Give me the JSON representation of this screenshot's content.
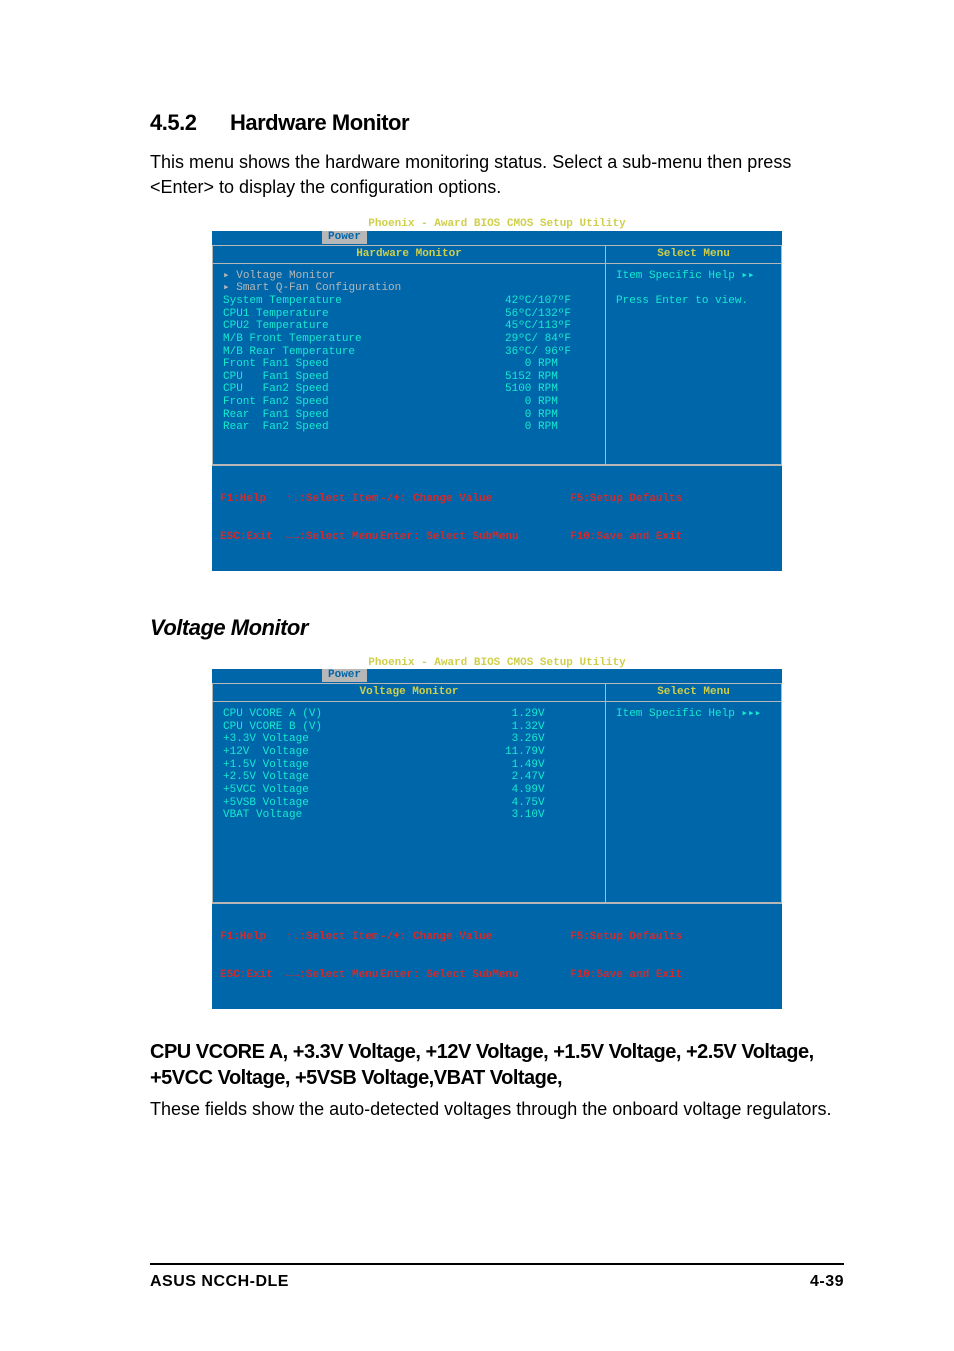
{
  "section": {
    "number": "4.5.2",
    "title": "Hardware Monitor",
    "intro": "This menu shows the hardware monitoring status. Select a sub-menu then press <Enter> to display the configuration options."
  },
  "bios_common": {
    "title": "Phoenix - Award BIOS CMOS Setup Utility",
    "tab": "Power",
    "right_header": "Select Menu",
    "help_header": "Item Specific Help",
    "footer": {
      "l1c1": "F1:Help   ↑↓:Select Item",
      "l1c2": "-/+: Change Value",
      "l1c3": "F5:Setup Defaults",
      "l2c1": "ESC:Exit  ←→:Select Menu",
      "l2c2": "Enter: Select SubMenu",
      "l2c3": "F10:Save and Exit"
    }
  },
  "bios1": {
    "left_header": "Hardware Monitor",
    "menu_items": [
      "Voltage Monitor",
      "Smart Q-Fan Configuration"
    ],
    "rows": [
      {
        "label": "System Temperature",
        "value": "42ºC/107ºF"
      },
      {
        "label": "CPU1 Temperature",
        "value": "56ºC/132ºF"
      },
      {
        "label": "CPU2 Temperature",
        "value": "45ºC/113ºF"
      },
      {
        "label": "M/B Front Temperature",
        "value": "29ºC/ 84ºF"
      },
      {
        "label": "M/B Rear Temperature",
        "value": "36ºC/ 96ºF"
      },
      {
        "label": "Front Fan1 Speed",
        "value": "   0 RPM"
      },
      {
        "label": "CPU   Fan1 Speed",
        "value": "5152 RPM"
      },
      {
        "label": "CPU   Fan2 Speed",
        "value": "5100 RPM"
      },
      {
        "label": "Front Fan2 Speed",
        "value": "   0 RPM"
      },
      {
        "label": "Rear  Fan1 Speed",
        "value": "   0 RPM"
      },
      {
        "label": "Rear  Fan2 Speed",
        "value": "   0 RPM"
      }
    ],
    "help_text": "Press Enter to view."
  },
  "voltage_heading": "Voltage Monitor",
  "bios2": {
    "left_header": "Voltage Monitor",
    "rows": [
      {
        "label": "CPU VCORE A (V)",
        "value": " 1.29V"
      },
      {
        "label": "CPU VCORE B (V)",
        "value": " 1.32V"
      },
      {
        "label": "+3.3V Voltage",
        "value": " 3.26V"
      },
      {
        "label": "+12V  Voltage",
        "value": "11.79V"
      },
      {
        "label": "+1.5V Voltage",
        "value": " 1.49V"
      },
      {
        "label": "+2.5V Voltage",
        "value": " 2.47V"
      },
      {
        "label": "+5VCC Voltage",
        "value": " 4.99V"
      },
      {
        "label": "+5VSB Voltage",
        "value": " 4.75V"
      },
      {
        "label": "VBAT Voltage",
        "value": " 3.10V"
      }
    ]
  },
  "fields_heading": "CPU VCORE A, +3.3V Voltage, +12V Voltage, +1.5V Voltage, +2.5V Voltage, +5VCC Voltage, +5VSB Voltage,VBAT Voltage,",
  "fields_body": "These fields show the auto-detected voltages through the onboard voltage regulators.",
  "footer": {
    "left": "ASUS NCCH-DLE",
    "right": "4-39"
  }
}
